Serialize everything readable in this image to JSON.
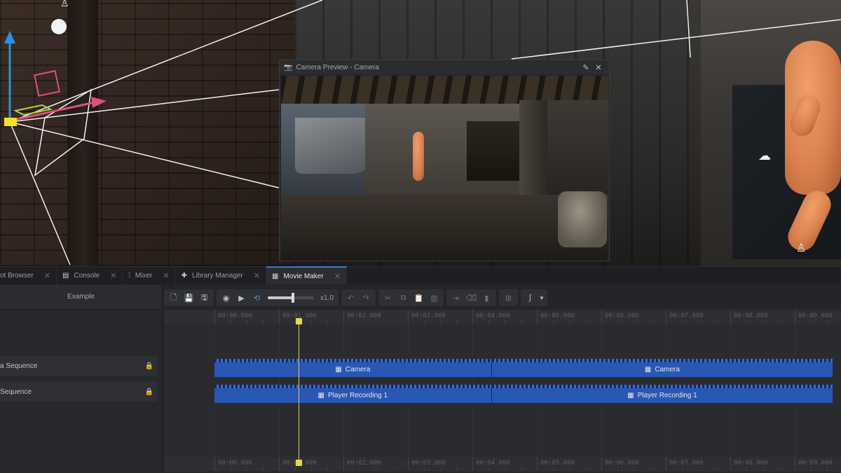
{
  "camera_preview": {
    "title": "Camera Preview - Camera",
    "icons": [
      "camera-icon",
      "pin-icon",
      "close-icon"
    ]
  },
  "tabs": [
    {
      "label": "ot Browser",
      "icon": "",
      "active": false
    },
    {
      "label": "Console",
      "icon": "document-icon",
      "active": false
    },
    {
      "label": "Mixer",
      "icon": "mixer-icon",
      "active": false
    },
    {
      "label": "Library Manager",
      "icon": "puzzle-icon",
      "active": false
    },
    {
      "label": "Movie Maker",
      "icon": "clapper-icon",
      "active": true
    }
  ],
  "movie_maker": {
    "project_name": "Example",
    "tracks": [
      {
        "label": "a Sequence"
      },
      {
        "label": "Sequence"
      }
    ],
    "toolbar": {
      "speed_label": "x1.0",
      "playback_speed_fraction": 0.55
    },
    "timeline": {
      "tick_labels": [
        "00:00.000",
        "00:01.000",
        "00:02.000",
        "00:03.000",
        "00:04.000",
        "00:05.000",
        "00:06.000",
        "00:07.000",
        "00:08.000",
        "00:09.000"
      ],
      "playhead_seconds": 1.3,
      "clips": [
        {
          "track": 0,
          "label": "Camera",
          "start": 0.0,
          "end": 4.3
        },
        {
          "track": 0,
          "label": "Camera",
          "start": 4.3,
          "end": 9.6
        },
        {
          "track": 1,
          "label": "Player Recording 1",
          "start": 0.0,
          "end": 4.3
        },
        {
          "track": 1,
          "label": "Player Recording 1",
          "start": 4.3,
          "end": 9.6
        }
      ]
    }
  },
  "colors": {
    "clip": "#2957b4",
    "active_tab_accent": "#3a7bd5",
    "playhead": "#e8d84a"
  }
}
